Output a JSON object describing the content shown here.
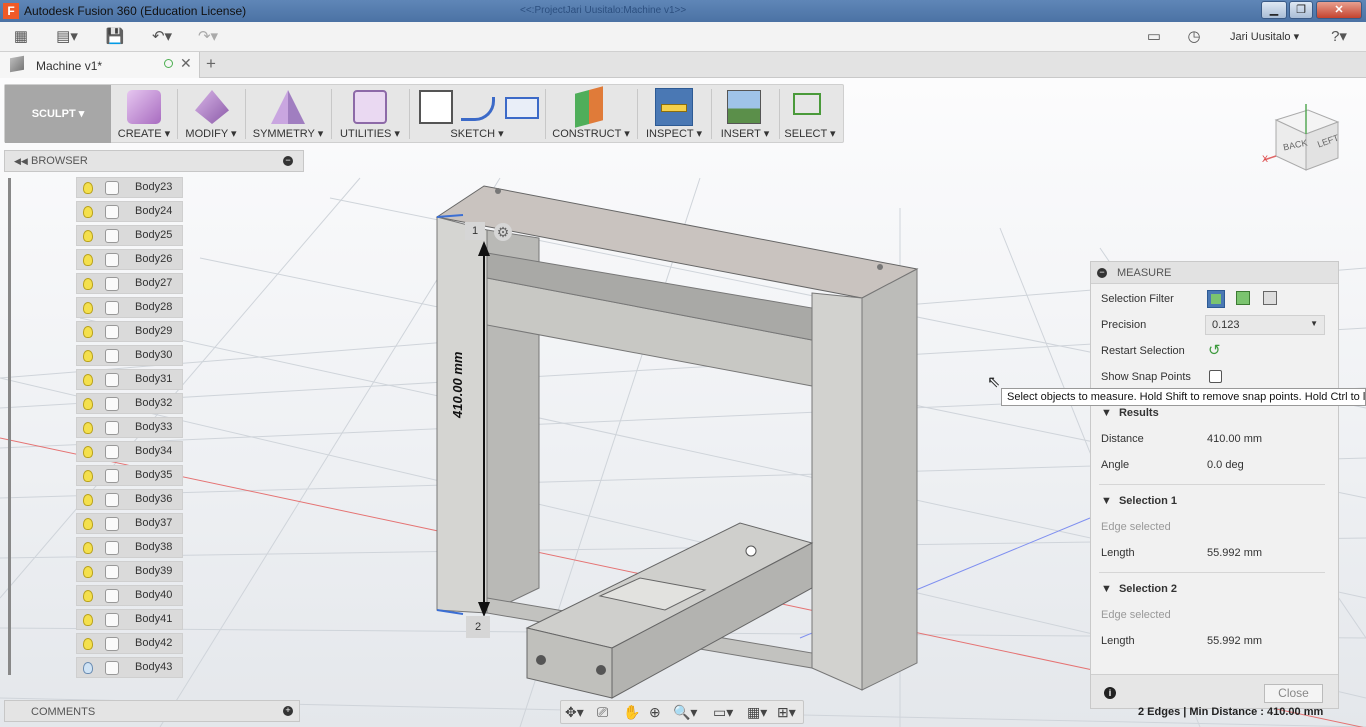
{
  "window": {
    "title": "Autodesk Fusion 360 (Education License)",
    "doc_path": "<<:ProjectJari Uusitalo:Machine v1>>"
  },
  "quick_access": {
    "user": "Jari Uusitalo"
  },
  "tab": {
    "name": "Machine v1*"
  },
  "workspace": {
    "label": "SCULPT"
  },
  "toolbar": {
    "groups": [
      {
        "label": "CREATE"
      },
      {
        "label": "MODIFY"
      },
      {
        "label": "SYMMETRY"
      },
      {
        "label": "UTILITIES"
      },
      {
        "label": "SKETCH"
      },
      {
        "label": "CONSTRUCT"
      },
      {
        "label": "INSPECT"
      },
      {
        "label": "INSERT"
      },
      {
        "label": "SELECT"
      }
    ]
  },
  "browser": {
    "title": "BROWSER",
    "items": [
      "Body23",
      "Body24",
      "Body25",
      "Body26",
      "Body27",
      "Body28",
      "Body29",
      "Body30",
      "Body31",
      "Body32",
      "Body33",
      "Body34",
      "Body35",
      "Body36",
      "Body37",
      "Body38",
      "Body39",
      "Body40",
      "Body41",
      "Body42",
      "Body43"
    ]
  },
  "comments": {
    "title": "COMMENTS"
  },
  "viewcube": {
    "back": "BACK",
    "left": "LEFT"
  },
  "dimension": {
    "value": "410.00 mm",
    "point1": "1",
    "point2": "2"
  },
  "measure": {
    "title": "MEASURE",
    "selection_filter_label": "Selection Filter",
    "precision_label": "Precision",
    "precision_value": "0.123",
    "restart_label": "Restart Selection",
    "snap_label": "Show Snap Points",
    "results_title": "Results",
    "distance_label": "Distance",
    "distance_value": "410.00 mm",
    "angle_label": "Angle",
    "angle_value": "0.0 deg",
    "sel1_title": "Selection 1",
    "sel1_desc": "Edge selected",
    "sel1_length_label": "Length",
    "sel1_length_value": "55.992 mm",
    "sel2_title": "Selection 2",
    "sel2_desc": "Edge selected",
    "sel2_length_label": "Length",
    "sel2_length_value": "55.992 mm",
    "close_label": "Close"
  },
  "tooltip": "Select objects to measure. Hold Shift to remove snap points. Hold Ctrl to lo",
  "status": "2 Edges | Min Distance : 410.00 mm",
  "colors": {
    "accent": "#4a78b4",
    "inspect_active": "#4a78b4",
    "grid": "#cdd2d8",
    "x_axis": "#e57373",
    "model": "#cfcfcc"
  }
}
